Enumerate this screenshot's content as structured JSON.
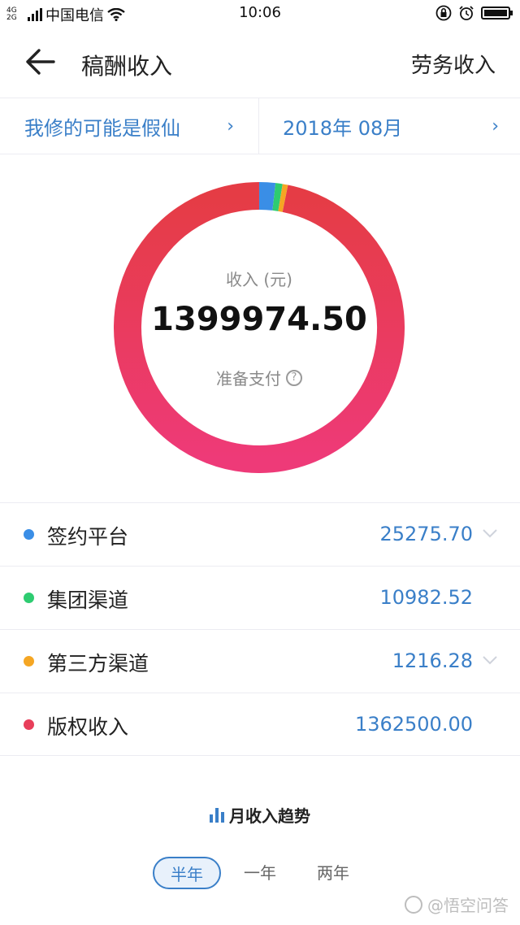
{
  "status_bar": {
    "network_top": "4G",
    "network_bottom": "2G",
    "carrier": "中国电信",
    "time": "10:06"
  },
  "nav": {
    "title": "稿酬收入",
    "right_link": "劳务收入"
  },
  "filter": {
    "author": "我修的可能是假仙",
    "period": "2018年 08月"
  },
  "summary": {
    "label": "收入 (元)",
    "amount": "1399974.50",
    "status": "准备支付"
  },
  "chart_data": {
    "type": "pie",
    "donut": true,
    "categories": [
      "签约平台",
      "集团渠道",
      "第三方渠道",
      "版权收入"
    ],
    "values": [
      25275.7,
      10982.52,
      1216.28,
      1362500.0
    ],
    "colors": [
      "#3a8ee6",
      "#2ecc71",
      "#f5a623",
      "#e83e5a"
    ]
  },
  "income_rows": [
    {
      "name": "签约平台",
      "value": "25275.70",
      "color": "#3a8ee6",
      "expandable": true
    },
    {
      "name": "集团渠道",
      "value": "10982.52",
      "color": "#2ecc71",
      "expandable": false
    },
    {
      "name": "第三方渠道",
      "value": "1216.28",
      "color": "#f5a623",
      "expandable": true
    },
    {
      "name": "版权收入",
      "value": "1362500.00",
      "color": "#e83e5a",
      "expandable": false
    }
  ],
  "trend": {
    "title": "月收入趋势",
    "tabs": [
      "半年",
      "一年",
      "两年"
    ],
    "active_tab": "半年"
  },
  "watermark": "@悟空问答"
}
